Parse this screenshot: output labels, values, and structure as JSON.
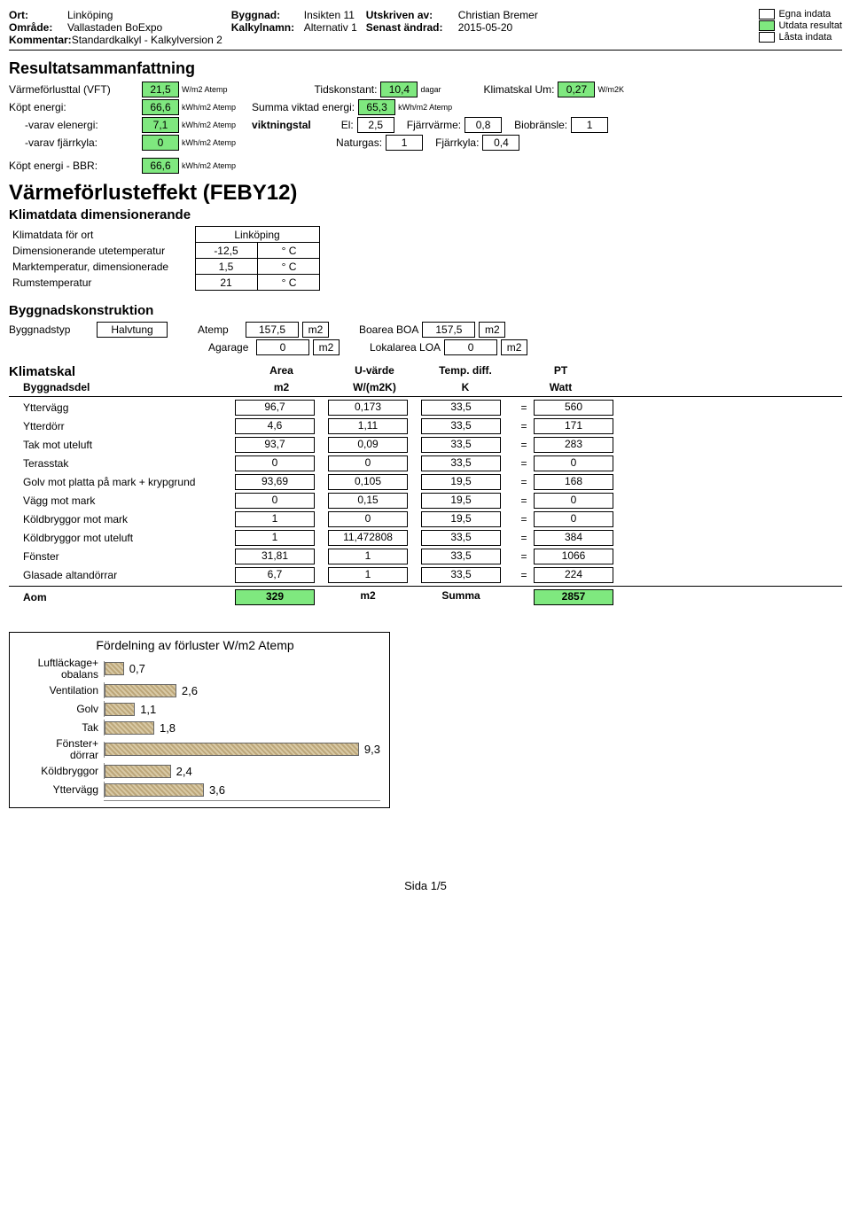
{
  "header": {
    "ort_lab": "Ort:",
    "ort": "Linköping",
    "omrade_lab": "Område:",
    "omrade": "Vallastaden BoExpo",
    "kommentar_lab": "Kommentar:",
    "kommentar": "Standardkalkyl - Kalkylversion 2",
    "byggnad_lab": "Byggnad:",
    "byggnad": "Insikten 11",
    "kalkylnamn_lab": "Kalkylnamn:",
    "kalkylnamn": "Alternativ 1",
    "utskriven_lab": "Utskriven av:",
    "utskriven": "Christian Bremer",
    "senast_lab": "Senast ändrad:",
    "senast": "2015-05-20",
    "legend_egna": "Egna indata",
    "legend_utdata": "Utdata resultat",
    "legend_lasta": "Låsta indata"
  },
  "resultat": {
    "title": "Resultatsammanfattning",
    "vft_lab": "Värmeförlusttal (VFT)",
    "vft": "21,5",
    "vft_unit": "W/m2 Atemp",
    "tids_lab": "Tidskonstant:",
    "tids": "10,4",
    "tids_unit": "dagar",
    "klim_lab": "Klimatskal Um:",
    "klim": "0,27",
    "klim_unit": "W/m2K",
    "kopt_lab": "Köpt energi:",
    "kopt": "66,6",
    "kopt_unit": "kWh/m2 Atemp",
    "summa_lab": "Summa viktad energi:",
    "summa": "65,3",
    "summa_unit": "kWh/m2 Atemp",
    "elen_lab": "-varav elenergi:",
    "elen": "7,1",
    "elen_unit": "kWh/m2 Atemp",
    "vikt_lab": "viktningstal",
    "el_lab": "El:",
    "el": "2,5",
    "fjarr_lab": "Fjärrvärme:",
    "fjarr": "0,8",
    "bio_lab": "Biobränsle:",
    "bio": "1",
    "fjk_lab": "-varav fjärrkyla:",
    "fjk": "0",
    "fjk_unit": "kWh/m2 Atemp",
    "nat_lab": "Naturgas:",
    "nat": "1",
    "fky_lab": "Fjärrkyla:",
    "fky": "0,4",
    "bbr_lab": "Köpt energi - BBR:",
    "bbr": "66,6",
    "bbr_unit": "kWh/m2 Atemp"
  },
  "feby": {
    "title": "Värmeförlusteffekt (FEBY12)",
    "klim_title": "Klimatdata dimensionerande",
    "rows": [
      {
        "lab": "Klimatdata för ort",
        "val": "Linköping",
        "unit": ""
      },
      {
        "lab": "Dimensionerande utetemperatur",
        "val": "-12,5",
        "unit": "° C"
      },
      {
        "lab": "Marktemperatur, dimensionerade",
        "val": "1,5",
        "unit": "° C"
      },
      {
        "lab": "Rumstemperatur",
        "val": "21",
        "unit": "° C"
      }
    ]
  },
  "byggkon": {
    "title": "Byggnadskonstruktion",
    "r1_lab": "Byggnadstyp",
    "r1_val": "Halvtung",
    "atemp_lab": "Atemp",
    "atemp": "157,5",
    "m2": "m2",
    "boa_lab": "Boarea BOA",
    "boa": "157,5",
    "agar_lab": "Agarage",
    "agar": "0",
    "loa_lab": "Lokalarea LOA",
    "loa": "0"
  },
  "klimat": {
    "title": "Klimatskal",
    "h": {
      "area": "Area",
      "uv": "U-värde",
      "td": "Temp. diff.",
      "pt": "PT"
    },
    "sh": {
      "bd": "Byggnadsdel",
      "m2": "m2",
      "w": "W/(m2K)",
      "k": "K",
      "watt": "Watt"
    },
    "rows": [
      {
        "n": "Yttervägg",
        "a": "96,7",
        "u": "0,173",
        "t": "33,5",
        "p": "560"
      },
      {
        "n": "Ytterdörr",
        "a": "4,6",
        "u": "1,11",
        "t": "33,5",
        "p": "171"
      },
      {
        "n": "Tak mot uteluft",
        "a": "93,7",
        "u": "0,09",
        "t": "33,5",
        "p": "283"
      },
      {
        "n": "Terasstak",
        "a": "0",
        "u": "0",
        "t": "33,5",
        "p": "0"
      },
      {
        "n": "Golv mot platta på mark  + krypgrund",
        "a": "93,69",
        "u": "0,105",
        "t": "19,5",
        "p": "168"
      },
      {
        "n": "Vägg mot mark",
        "a": "0",
        "u": "0,15",
        "t": "19,5",
        "p": "0"
      },
      {
        "n": "Köldbryggor mot mark",
        "a": "1",
        "u": "0",
        "t": "19,5",
        "p": "0"
      },
      {
        "n": "Köldbryggor mot uteluft",
        "a": "1",
        "u": "11,472808",
        "t": "33,5",
        "p": "384"
      },
      {
        "n": "Fönster",
        "a": "31,81",
        "u": "1",
        "t": "33,5",
        "p": "1066"
      },
      {
        "n": "Glasade altandörrar",
        "a": "6,7",
        "u": "1",
        "t": "33,5",
        "p": "224"
      }
    ],
    "sum": {
      "n": "Aom",
      "a": "329",
      "u": "m2",
      "t": "Summa",
      "p": "2857"
    },
    "eq": "="
  },
  "chart_data": {
    "type": "bar",
    "title": "Fördelning av förluster W/m2 Atemp",
    "categories": [
      "Luftläckage+ obalans",
      "Ventilation",
      "Golv",
      "Tak",
      "Fönster+ dörrar",
      "Köldbryggor",
      "Yttervägg"
    ],
    "values": [
      0.7,
      2.6,
      1.1,
      1.8,
      9.3,
      2.4,
      3.6
    ],
    "xlim": [
      0,
      10
    ],
    "xlabel": "",
    "ylabel": ""
  },
  "footer": {
    "page": "Sida 1/5"
  }
}
